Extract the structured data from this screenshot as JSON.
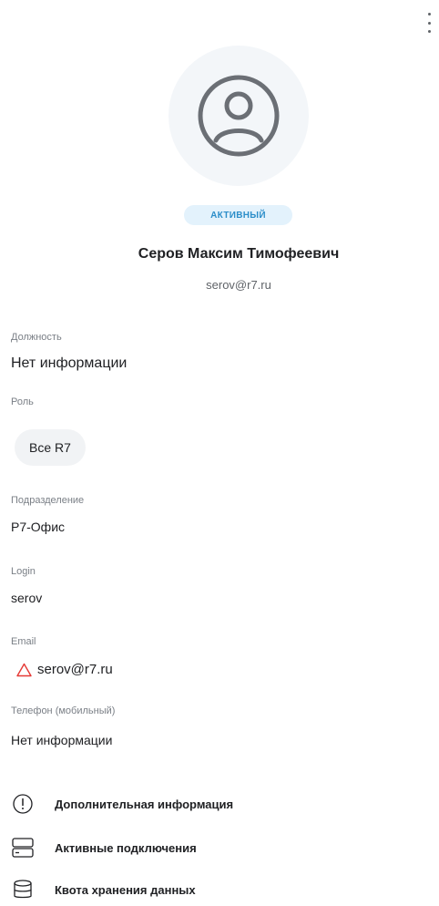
{
  "header": {
    "more_icon": "more-vertical-icon"
  },
  "profile": {
    "avatar_icon": "user-circle-icon",
    "status": "АКТИВНЫЙ",
    "name": "Серов Максим Тимофеевич",
    "email": "serov@r7.ru"
  },
  "fields": {
    "position": {
      "label": "Должность",
      "value": "Нет информации"
    },
    "role": {
      "label": "Роль",
      "value": "Все R7"
    },
    "department": {
      "label": "Подразделение",
      "value": "Р7-Офис"
    },
    "login": {
      "label": "Login",
      "value": "serov"
    },
    "email": {
      "label": "Email",
      "value": "serov@r7.ru",
      "warning_icon": "warning-triangle-icon"
    },
    "phone": {
      "label": "Телефон (мобильный)",
      "value": "Нет информации"
    }
  },
  "menu": [
    {
      "label": "Дополнительная информация",
      "icon": "info-circle-icon"
    },
    {
      "label": "Активные подключения",
      "icon": "server-icon"
    },
    {
      "label": "Квота хранения данных",
      "icon": "database-icon"
    }
  ],
  "colors": {
    "status_bg": "#e3f2fc",
    "status_text": "#2c8ec9",
    "warning": "#e53935",
    "avatar_bg": "#f3f6f9",
    "avatar_stroke": "#6b6f75"
  }
}
